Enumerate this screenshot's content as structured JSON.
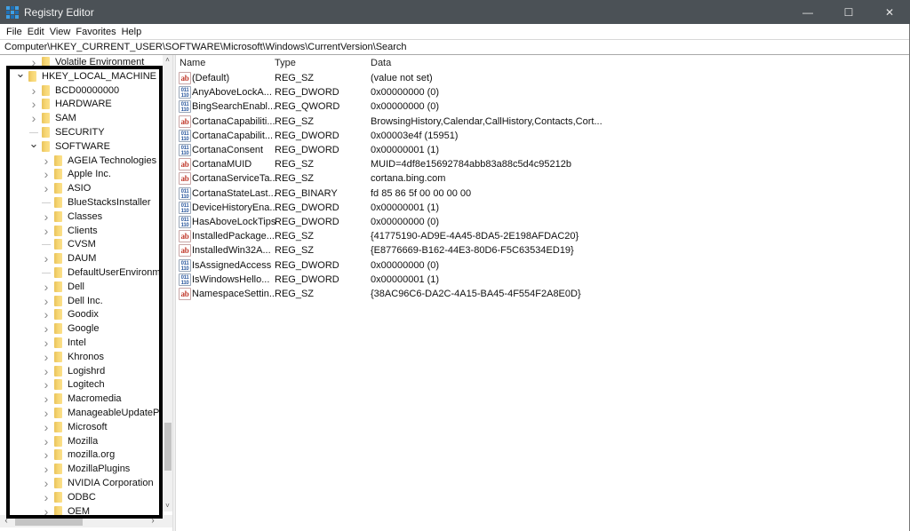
{
  "window": {
    "title": "Registry Editor",
    "controls": {
      "minimize": "—",
      "maximize": "☐",
      "close": "✕"
    }
  },
  "menu": [
    "File",
    "Edit",
    "View",
    "Favorites",
    "Help"
  ],
  "address": "Computer\\HKEY_CURRENT_USER\\SOFTWARE\\Microsoft\\Windows\\CurrentVersion\\Search",
  "tree": [
    {
      "label": "Volatile Environment",
      "level": 2,
      "expander": "collapsed"
    },
    {
      "label": "HKEY_LOCAL_MACHINE",
      "level": 1,
      "expander": "expanded"
    },
    {
      "label": "BCD00000000",
      "level": 2,
      "expander": "collapsed"
    },
    {
      "label": "HARDWARE",
      "level": 2,
      "expander": "collapsed"
    },
    {
      "label": "SAM",
      "level": 2,
      "expander": "collapsed"
    },
    {
      "label": "SECURITY",
      "level": 2,
      "expander": "none"
    },
    {
      "label": "SOFTWARE",
      "level": 2,
      "expander": "expanded"
    },
    {
      "label": "AGEIA Technologies",
      "level": 3,
      "expander": "collapsed"
    },
    {
      "label": "Apple Inc.",
      "level": 3,
      "expander": "collapsed"
    },
    {
      "label": "ASIO",
      "level": 3,
      "expander": "collapsed"
    },
    {
      "label": "BlueStacksInstaller",
      "level": 3,
      "expander": "none"
    },
    {
      "label": "Classes",
      "level": 3,
      "expander": "collapsed"
    },
    {
      "label": "Clients",
      "level": 3,
      "expander": "collapsed"
    },
    {
      "label": "CVSM",
      "level": 3,
      "expander": "none"
    },
    {
      "label": "DAUM",
      "level": 3,
      "expander": "collapsed"
    },
    {
      "label": "DefaultUserEnvironme",
      "level": 3,
      "expander": "none"
    },
    {
      "label": "Dell",
      "level": 3,
      "expander": "collapsed"
    },
    {
      "label": "Dell Inc.",
      "level": 3,
      "expander": "collapsed"
    },
    {
      "label": "Goodix",
      "level": 3,
      "expander": "collapsed"
    },
    {
      "label": "Google",
      "level": 3,
      "expander": "collapsed"
    },
    {
      "label": "Intel",
      "level": 3,
      "expander": "collapsed"
    },
    {
      "label": "Khronos",
      "level": 3,
      "expander": "collapsed"
    },
    {
      "label": "Logishrd",
      "level": 3,
      "expander": "collapsed"
    },
    {
      "label": "Logitech",
      "level": 3,
      "expander": "collapsed"
    },
    {
      "label": "Macromedia",
      "level": 3,
      "expander": "collapsed"
    },
    {
      "label": "ManageableUpdatePa",
      "level": 3,
      "expander": "collapsed"
    },
    {
      "label": "Microsoft",
      "level": 3,
      "expander": "collapsed"
    },
    {
      "label": "Mozilla",
      "level": 3,
      "expander": "collapsed"
    },
    {
      "label": "mozilla.org",
      "level": 3,
      "expander": "collapsed"
    },
    {
      "label": "MozillaPlugins",
      "level": 3,
      "expander": "collapsed"
    },
    {
      "label": "NVIDIA Corporation",
      "level": 3,
      "expander": "collapsed"
    },
    {
      "label": "ODBC",
      "level": 3,
      "expander": "collapsed"
    },
    {
      "label": "OEM",
      "level": 3,
      "expander": "collapsed"
    }
  ],
  "list": {
    "columns": {
      "name": "Name",
      "type": "Type",
      "data": "Data"
    },
    "rows": [
      {
        "icon": "string",
        "name": "(Default)",
        "type": "REG_SZ",
        "data": "(value not set)"
      },
      {
        "icon": "binary",
        "name": "AnyAboveLockA...",
        "type": "REG_DWORD",
        "data": "0x00000000 (0)"
      },
      {
        "icon": "binary",
        "name": "BingSearchEnabl...",
        "type": "REG_QWORD",
        "data": "0x00000000 (0)"
      },
      {
        "icon": "string",
        "name": "CortanaCapabiliti...",
        "type": "REG_SZ",
        "data": "BrowsingHistory,Calendar,CallHistory,Contacts,Cort..."
      },
      {
        "icon": "binary",
        "name": "CortanaCapabilit...",
        "type": "REG_DWORD",
        "data": "0x00003e4f (15951)"
      },
      {
        "icon": "binary",
        "name": "CortanaConsent",
        "type": "REG_DWORD",
        "data": "0x00000001 (1)"
      },
      {
        "icon": "string",
        "name": "CortanaMUID",
        "type": "REG_SZ",
        "data": "MUID=4df8e15692784abb83a88c5d4c95212b"
      },
      {
        "icon": "string",
        "name": "CortanaServiceTa...",
        "type": "REG_SZ",
        "data": "cortana.bing.com"
      },
      {
        "icon": "binary",
        "name": "CortanaStateLast...",
        "type": "REG_BINARY",
        "data": "fd 85 86 5f 00 00 00 00"
      },
      {
        "icon": "binary",
        "name": "DeviceHistoryEna...",
        "type": "REG_DWORD",
        "data": "0x00000001 (1)"
      },
      {
        "icon": "binary",
        "name": "HasAboveLockTips",
        "type": "REG_DWORD",
        "data": "0x00000000 (0)"
      },
      {
        "icon": "string",
        "name": "InstalledPackage...",
        "type": "REG_SZ",
        "data": "{41775190-AD9E-4A45-8DA5-2E198AFDAC20}"
      },
      {
        "icon": "string",
        "name": "InstalledWin32A...",
        "type": "REG_SZ",
        "data": "{E8776669-B162-44E3-80D6-F5C63534ED19}"
      },
      {
        "icon": "binary",
        "name": "IsAssignedAccess",
        "type": "REG_DWORD",
        "data": "0x00000000 (0)"
      },
      {
        "icon": "binary",
        "name": "IsWindowsHello...",
        "type": "REG_DWORD",
        "data": "0x00000001 (1)"
      },
      {
        "icon": "string",
        "name": "NamespaceSettin...",
        "type": "REG_SZ",
        "data": "{38AC96C6-DA2C-4A15-BA45-4F554F2A8E0D}"
      }
    ]
  },
  "icon_glyphs": {
    "string": "ab",
    "binary": "011\n110"
  },
  "scroll": {
    "tree_vertical_up": "˄",
    "tree_vertical_down": "˅",
    "tree_horizontal_left": "‹",
    "tree_horizontal_right": "›"
  },
  "colors": {
    "titlebar": "#4b5156",
    "folder": "#f7d775",
    "highlight_box": "#000000"
  }
}
